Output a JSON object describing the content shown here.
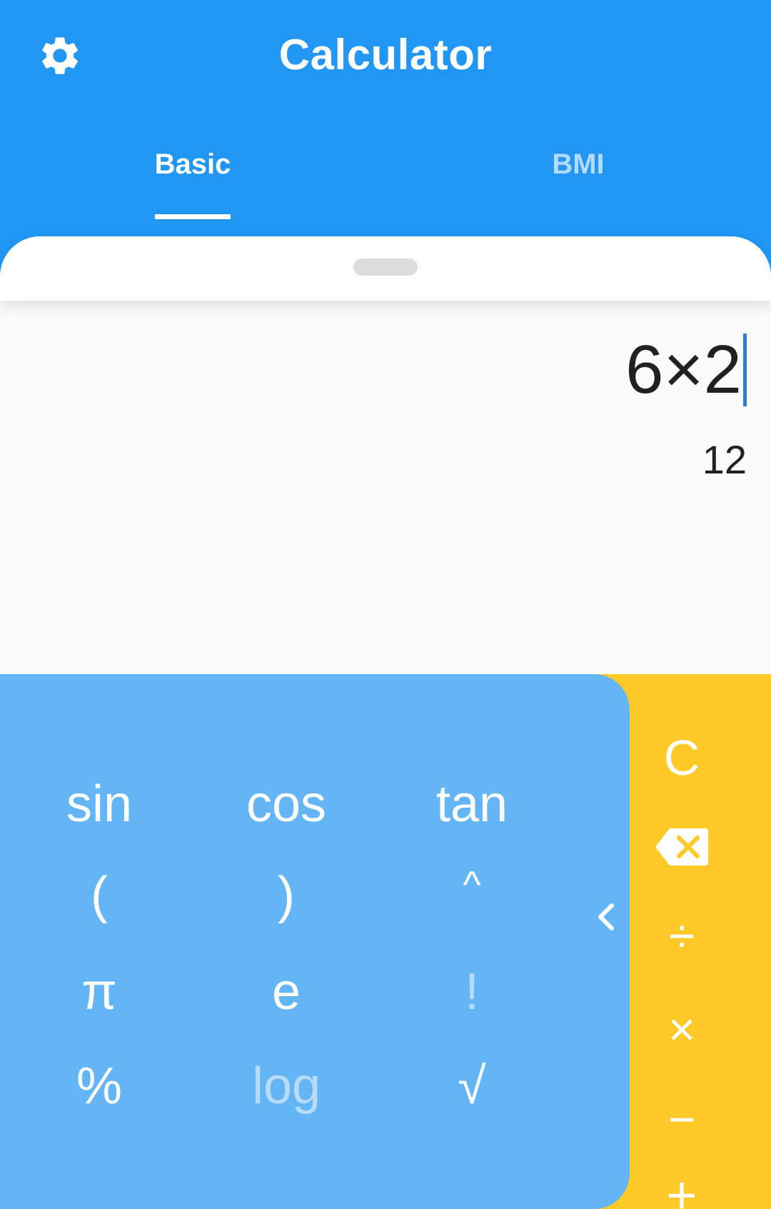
{
  "header": {
    "title": "Calculator",
    "settings_icon": "gear-icon",
    "tabs": [
      {
        "label": "Basic",
        "active": true
      },
      {
        "label": "BMI",
        "active": false
      }
    ]
  },
  "display": {
    "expression": "6×2",
    "result": "12"
  },
  "scientific_keys": {
    "sin": "sin",
    "cos": "cos",
    "tan": "tan",
    "lparen": "(",
    "rparen": ")",
    "power": "^",
    "pi": "π",
    "e": "e",
    "factorial": "!",
    "percent": "%",
    "log": "log",
    "sqrt": "√"
  },
  "operator_keys": {
    "clear": "C",
    "backspace_icon": "backspace-icon",
    "divide": "÷",
    "multiply": "×",
    "minus": "−",
    "plus": "+"
  },
  "colors": {
    "primary": "#2196f3",
    "keypad_blue": "#64b5f6",
    "operator_yellow": "#ffca28",
    "caret": "#2f7bd8"
  }
}
